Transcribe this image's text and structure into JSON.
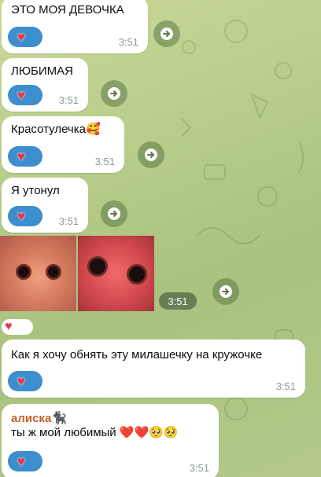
{
  "messages": [
    {
      "text": "ЭТО МОЯ ДЕВОЧКА",
      "time": "3:51"
    },
    {
      "text": "ЛЮБИМАЯ",
      "time": "3:51"
    },
    {
      "text": "Красотулечка",
      "emoji": "🥰",
      "time": "3:51"
    },
    {
      "text": "Я утонул",
      "time": "3:51"
    },
    {
      "text": "Как я хочу обнять эту милашечку на кружочке",
      "time": "3:51"
    },
    {
      "sender": "алиска",
      "sender_emoji": "🐈‍⬛",
      "text": "ты ж мой любимый ❤️❤️🥺🥺",
      "time": "3:51"
    }
  ],
  "photo_album": {
    "time": "3:51"
  },
  "reaction_icon": "heart-sticker",
  "forward_icon": "forward-arrow-icon",
  "colors": {
    "reaction_bg": "#3d8ecf",
    "sender": "#c7612c",
    "time": "#8c9a96"
  }
}
